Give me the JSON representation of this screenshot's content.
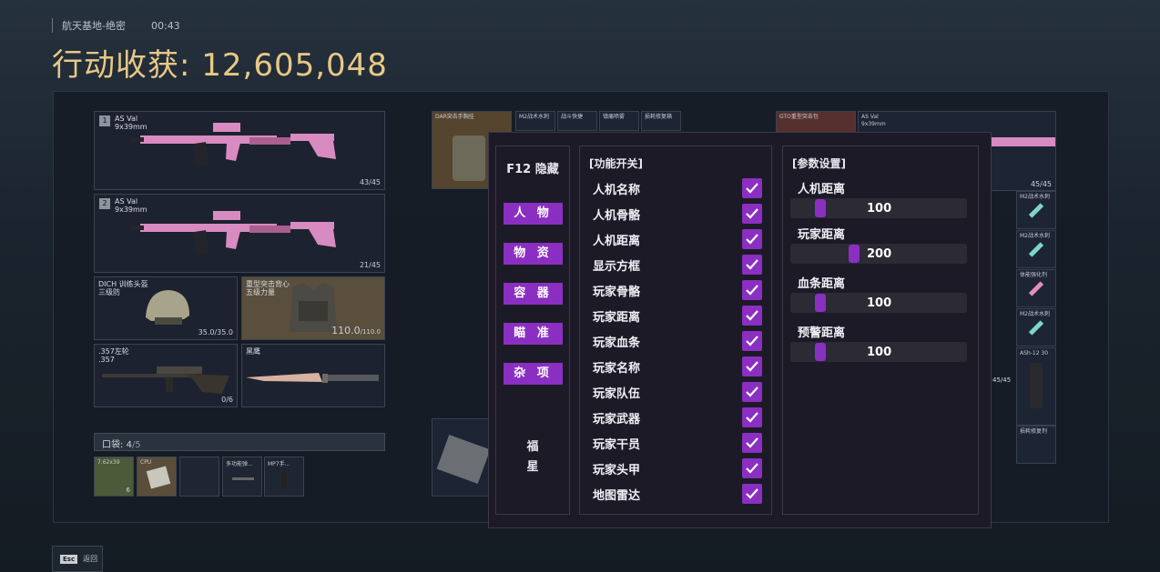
{
  "header": {
    "map": "航天基地-绝密",
    "time": "00:43",
    "title": "行动收获: 12,605,048"
  },
  "loadout": {
    "slot1": {
      "num": "1",
      "name": "AS Val",
      "ammo": "9x39mm",
      "count": "43/45"
    },
    "slot2": {
      "num": "2",
      "name": "AS Val",
      "ammo": "9x39mm",
      "count": "21/45"
    },
    "helmet": {
      "name": "DICH 训练头盔",
      "sub": "三级防",
      "value": "35.0/35.0"
    },
    "armor": {
      "name": "重型突击背心",
      "sub": "五级力量",
      "value": "110.0",
      "max": "/110.0"
    },
    "sniper": {
      "name": ".357左轮",
      "sub": ".357",
      "count": "0/6"
    },
    "knife": {
      "name": "黑鹰"
    }
  },
  "pockets": {
    "label": "口袋:",
    "count": "4",
    "max": "/5",
    "items": [
      {
        "name": "7.62x39",
        "count": "6"
      },
      {
        "name": "CPU"
      },
      {
        "name": ""
      },
      {
        "name": "多功能弹..."
      },
      {
        "name": "MP7手..."
      }
    ]
  },
  "middle_items": [
    "DAR突击手胸挂",
    "M2战术水刺",
    "战斗快捷",
    "镇痛喷雾",
    "损耗修复箱"
  ],
  "right_items": {
    "vest": "GTO重型突击包",
    "gun": "AS Val",
    "gun_ammo": "9x39mm",
    "gun_count": "45/45",
    "syringes": [
      "M2战术水刺",
      "M2战术水刺",
      "体能强化剂",
      "M2战术水刺",
      "ASh-12 30",
      "损耗修复剂",
      "损耗修复剂"
    ],
    "count2": "45/45"
  },
  "cheat_menu": {
    "hide_label": "F12 隐藏",
    "categories": [
      "人 物",
      "物 资",
      "容 器",
      "瞄 准",
      "杂 项"
    ],
    "brand": [
      "福",
      "星"
    ],
    "func_header": "[功能开关]",
    "functions": [
      "人机名称",
      "人机骨骼",
      "人机距离",
      "显示方框",
      "玩家骨骼",
      "玩家距离",
      "玩家血条",
      "玩家名称",
      "玩家队伍",
      "玩家武器",
      "玩家干员",
      "玩家头甲",
      "地图雷达"
    ],
    "param_header": "[参数设置]",
    "params": [
      {
        "label": "人机距离",
        "value": "100",
        "fraction": 0.14
      },
      {
        "label": "玩家距离",
        "value": "200",
        "fraction": 0.33
      },
      {
        "label": "血条距离",
        "value": "100",
        "fraction": 0.14
      },
      {
        "label": "预警距离",
        "value": "100",
        "fraction": 0.14
      }
    ],
    "accent": "#8a2fc2"
  },
  "footer": {
    "key": "Esc",
    "label": "返回"
  }
}
